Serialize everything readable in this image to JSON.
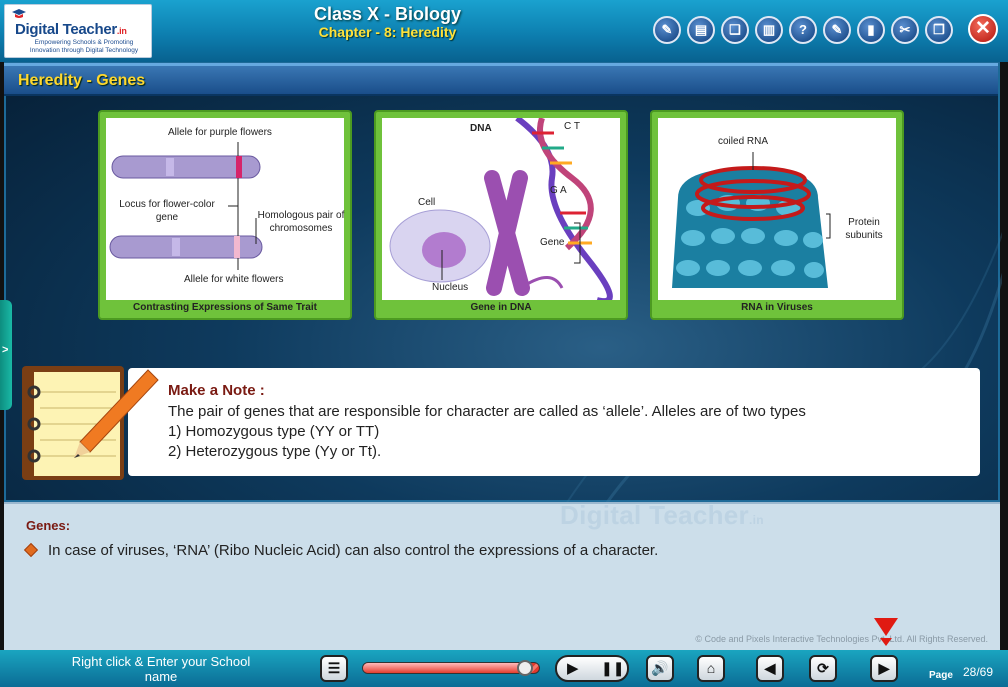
{
  "header": {
    "logo_main": "Digital Teacher",
    "logo_suffix": ".in",
    "logo_tagline": "Empowering Schools & Promoting Innovation through Digital Technology",
    "title": "Class X - Biology",
    "subtitle": "Chapter - 8: Heredity",
    "toolbar_icons": [
      "notes-icon",
      "book-icon",
      "bookmark-icon",
      "print-icon",
      "help-icon",
      "pin-icon",
      "red-book-icon",
      "tools-icon",
      "window-icon"
    ],
    "toolbar_glyphs": [
      "✎",
      "▤",
      "❑",
      "▥",
      "?",
      "✎",
      "▮",
      "✂",
      "❐"
    ],
    "close_label": "✕"
  },
  "section": {
    "title": "Heredity - Genes"
  },
  "side_tab_glyph": ">",
  "cards": [
    {
      "caption": "Contrasting Expressions of Same Trait",
      "labels": {
        "top": "Allele for purple flowers",
        "locus": "Locus for flower-color gene",
        "homolog": "Homologous pair of chromosomes",
        "bottom": "Allele for white flowers"
      }
    },
    {
      "caption": "Gene in DNA",
      "labels": {
        "dna": "DNA",
        "ct": "C T",
        "ga": "G A",
        "cell": "Cell",
        "gene": "Gene",
        "nucleus": "Nucleus"
      }
    },
    {
      "caption": "RNA in Viruses",
      "labels": {
        "rna": "coiled RNA",
        "protein": "Protein subunits"
      }
    }
  ],
  "note": {
    "heading": "Make a Note :",
    "line1": "The pair of genes that are responsible for character are called as ‘allele’. Alleles are of two types",
    "line2": "1) Homozygous type (YY or TT)",
    "line3": "2) Heterozygous type (Yy or Tt)."
  },
  "lower": {
    "heading": "Genes:",
    "bullet": "In case of viruses, ‘RNA’ (Ribo Nucleic Acid) can also control the expressions of a character.",
    "watermark": "Digital Teacher",
    "watermark_suffix": ".in",
    "copyright": "© Code and Pixels Interactive Technologies  Pvt. Ltd. All Rights Reserved."
  },
  "footer": {
    "school_prompt": "Right click & Enter your School name",
    "progress_fraction": 0.93,
    "page_label": "Page",
    "page_current": "28/69",
    "icons": {
      "menu": "☰",
      "volume": "🔊",
      "home": "⌂",
      "prev": "◀",
      "refresh": "⟳",
      "next": "▶",
      "play": "▶",
      "pause": "❚❚"
    }
  },
  "colors": {
    "accent_green": "#6fc23b",
    "title_yellow": "#ffe23a",
    "note_red": "#7a1a12",
    "header_blue": "#0d7fb0"
  }
}
